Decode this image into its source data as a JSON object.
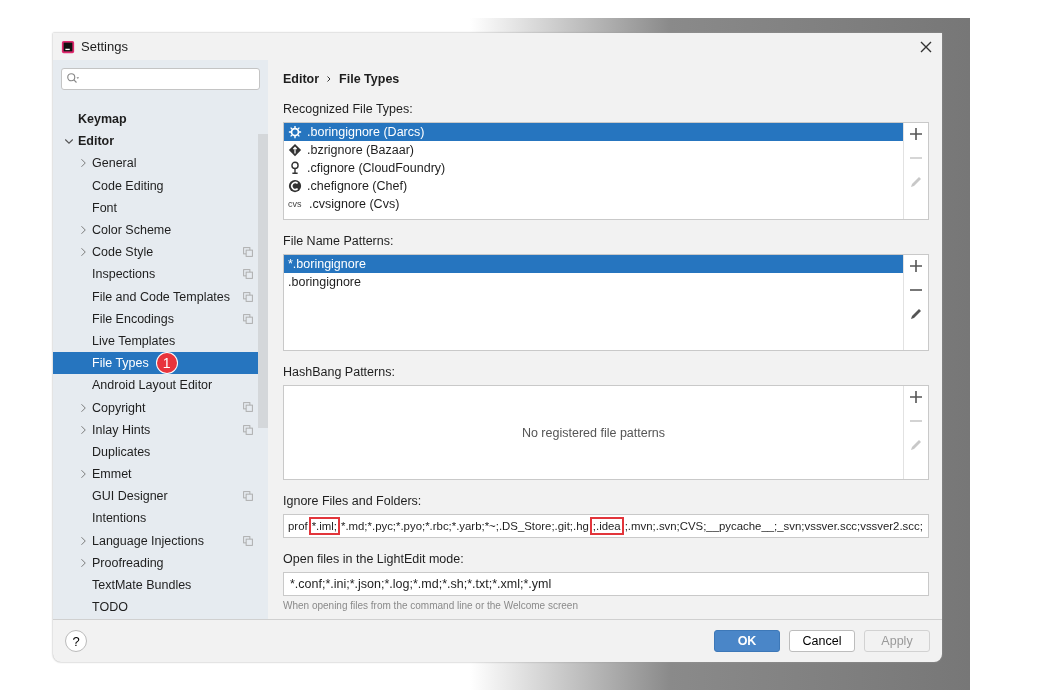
{
  "window": {
    "title": "Settings"
  },
  "sidebar": {
    "items": [
      {
        "label": "Keymap",
        "bold": true,
        "expandable": false,
        "project_scope": false,
        "selected": false
      },
      {
        "label": "Editor",
        "bold": true,
        "expandable": true,
        "expanded": true,
        "project_scope": false,
        "selected": false,
        "children": [
          {
            "label": "General",
            "expandable": true,
            "expanded": false,
            "project_scope": false,
            "selected": false
          },
          {
            "label": "Code Editing",
            "expandable": false,
            "project_scope": false,
            "selected": false
          },
          {
            "label": "Font",
            "expandable": false,
            "project_scope": false,
            "selected": false
          },
          {
            "label": "Color Scheme",
            "expandable": true,
            "expanded": false,
            "project_scope": false,
            "selected": false
          },
          {
            "label": "Code Style",
            "expandable": true,
            "expanded": false,
            "project_scope": true,
            "selected": false
          },
          {
            "label": "Inspections",
            "expandable": false,
            "project_scope": true,
            "selected": false
          },
          {
            "label": "File and Code Templates",
            "expandable": false,
            "project_scope": true,
            "selected": false
          },
          {
            "label": "File Encodings",
            "expandable": false,
            "project_scope": true,
            "selected": false
          },
          {
            "label": "Live Templates",
            "expandable": false,
            "project_scope": false,
            "selected": false
          },
          {
            "label": "File Types",
            "expandable": false,
            "project_scope": false,
            "selected": true,
            "badge": "1"
          },
          {
            "label": "Android Layout Editor",
            "expandable": false,
            "project_scope": false,
            "selected": false
          },
          {
            "label": "Copyright",
            "expandable": true,
            "expanded": false,
            "project_scope": true,
            "selected": false
          },
          {
            "label": "Inlay Hints",
            "expandable": true,
            "expanded": false,
            "project_scope": true,
            "selected": false
          },
          {
            "label": "Duplicates",
            "expandable": false,
            "project_scope": false,
            "selected": false
          },
          {
            "label": "Emmet",
            "expandable": true,
            "expanded": false,
            "project_scope": false,
            "selected": false
          },
          {
            "label": "GUI Designer",
            "expandable": false,
            "project_scope": true,
            "selected": false
          },
          {
            "label": "Intentions",
            "expandable": false,
            "project_scope": false,
            "selected": false
          },
          {
            "label": "Language Injections",
            "expandable": true,
            "expanded": false,
            "project_scope": true,
            "selected": false
          },
          {
            "label": "Proofreading",
            "expandable": true,
            "expanded": false,
            "project_scope": false,
            "selected": false
          },
          {
            "label": "TextMate Bundles",
            "expandable": false,
            "project_scope": false,
            "selected": false
          },
          {
            "label": "TODO",
            "expandable": false,
            "project_scope": false,
            "selected": false
          }
        ]
      }
    ]
  },
  "breadcrumb": [
    "Editor",
    "File Types"
  ],
  "recognized_file_types": {
    "label": "Recognized File Types:",
    "items": [
      {
        "label": ".boringignore (Darcs)",
        "kind": "gear",
        "selected": true
      },
      {
        "label": ".bzrignore (Bazaar)",
        "kind": "diamond",
        "selected": false
      },
      {
        "label": ".cfignore (CloudFoundry)",
        "kind": "pin",
        "selected": false
      },
      {
        "label": ".chefignore (Chef)",
        "kind": "chef",
        "selected": false
      },
      {
        "label": ".cvsignore (Cvs)",
        "kind": "text",
        "icon_text": "cvs",
        "selected": false
      }
    ],
    "toolbar": [
      {
        "kind": "add",
        "disabled": false
      },
      {
        "kind": "remove",
        "disabled": true
      },
      {
        "kind": "edit",
        "disabled": true
      }
    ]
  },
  "file_name_patterns": {
    "label": "File Name Patterns:",
    "items": [
      {
        "label": "*.boringignore",
        "selected": true
      },
      {
        "label": ".boringignore",
        "selected": false
      }
    ],
    "toolbar": [
      {
        "kind": "add",
        "disabled": false
      },
      {
        "kind": "remove",
        "disabled": false
      },
      {
        "kind": "edit",
        "disabled": false
      }
    ]
  },
  "hashbang_patterns": {
    "label": "HashBang Patterns:",
    "empty_text": "No registered file patterns",
    "toolbar": [
      {
        "kind": "add",
        "disabled": false
      },
      {
        "kind": "remove",
        "disabled": true
      },
      {
        "kind": "edit",
        "disabled": true
      }
    ]
  },
  "ignore_files": {
    "label": "Ignore Files and Folders:",
    "segments": [
      {
        "text": "prof",
        "highlighted": false
      },
      {
        "text": "*.iml;",
        "highlighted": true
      },
      {
        "text": "*.md;*.pyc;*.pyo;*.rbc;*.yarb;*~;.DS_Store;.git;.hg",
        "highlighted": false
      },
      {
        "text": ";.idea",
        "highlighted": true
      },
      {
        "text": ";.mvn;.svn;CVS;__pycache__;_svn;vssver.scc;vssver2.scc;",
        "highlighted": false
      }
    ]
  },
  "lightedit": {
    "label": "Open files in the LightEdit mode:",
    "value": "*.conf;*.ini;*.json;*.log;*.md;*.sh;*.txt;*.xml;*.yml",
    "hint": "When opening files from the command line or the Welcome screen"
  },
  "buttons": [
    {
      "label": "OK",
      "kind": "primary",
      "disabled": false
    },
    {
      "label": "Cancel",
      "kind": "normal",
      "disabled": false
    },
    {
      "label": "Apply",
      "kind": "normal",
      "disabled": true
    }
  ],
  "help_button": "?"
}
